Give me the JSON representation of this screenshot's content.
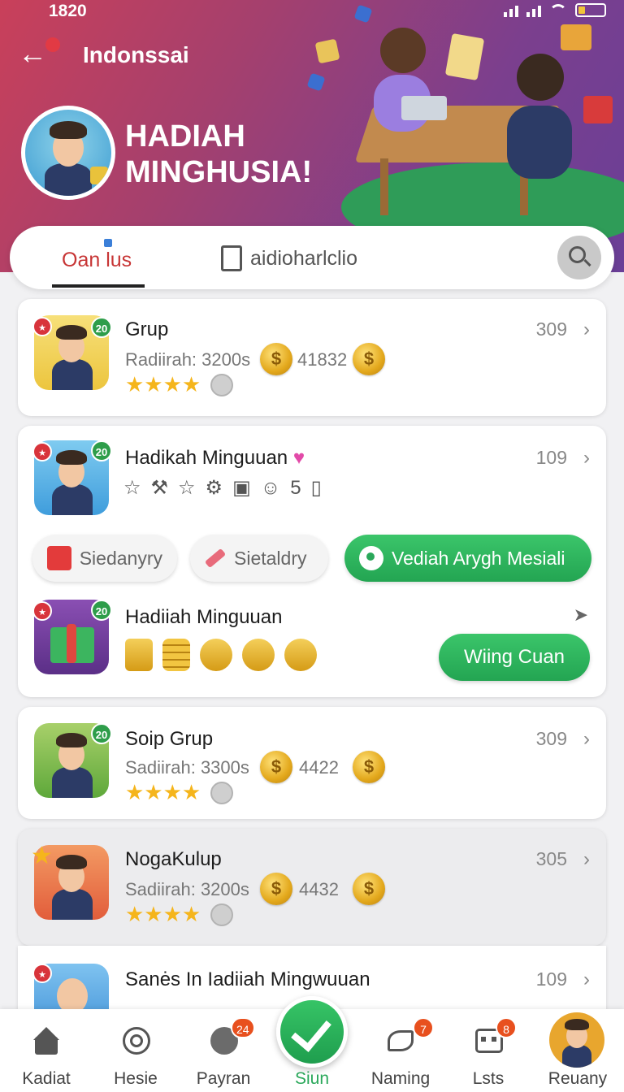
{
  "status_bar": {
    "time": "1820"
  },
  "header": {
    "app_title": "Indonssai",
    "hero_title_line1": "HADIAH",
    "hero_title_line2": "MINGHUSIA!"
  },
  "tabs": {
    "active_label": "Oan lus",
    "second_label": "aidioharlclio"
  },
  "cards": [
    {
      "title": "Grup",
      "sub": "Radiirah: 3200s",
      "coin_value": "41832",
      "count": "309",
      "badge": "20",
      "rating": 4
    },
    {
      "title": "Hadikah Minguuan",
      "count": "109",
      "badge": "20",
      "icons_count": "5",
      "pills": [
        "Siedanyry",
        "Sietaldry",
        "Vediah Arygh Mesiali"
      ],
      "sub_title": "Hadiiah Minguuan",
      "sub_badge": "20",
      "win_button": "Wiing Cuan"
    },
    {
      "title": "Soip Grup",
      "sub": "Sadiirah: 3300s",
      "coin_value": "4422",
      "count": "309",
      "badge": "20",
      "rating": 4
    },
    {
      "title": "NogaKulup",
      "sub": "Sadiirah: 3200s",
      "coin_value": "4432",
      "count": "305",
      "rating": 4
    },
    {
      "title": "Sanės In Iadiiah Mingwuuan",
      "count": "109"
    }
  ],
  "nav": {
    "items": [
      {
        "label": "Kadiat",
        "icon": "home-icon"
      },
      {
        "label": "Hesie",
        "icon": "target-icon"
      },
      {
        "label": "Payran",
        "icon": "globe-icon",
        "badge": "24"
      },
      {
        "label": "Siun",
        "icon": "check-icon"
      },
      {
        "label": "Naming",
        "icon": "leaf-icon",
        "badge": "7"
      },
      {
        "label": "Lsts",
        "icon": "grid-icon",
        "badge": "8"
      },
      {
        "label": "Reuany",
        "icon": "avatar"
      }
    ]
  },
  "colors": {
    "accent_green": "#23a552",
    "header_start": "#c9405a",
    "header_end": "#6a3f97",
    "tab_active": "#c73535"
  }
}
